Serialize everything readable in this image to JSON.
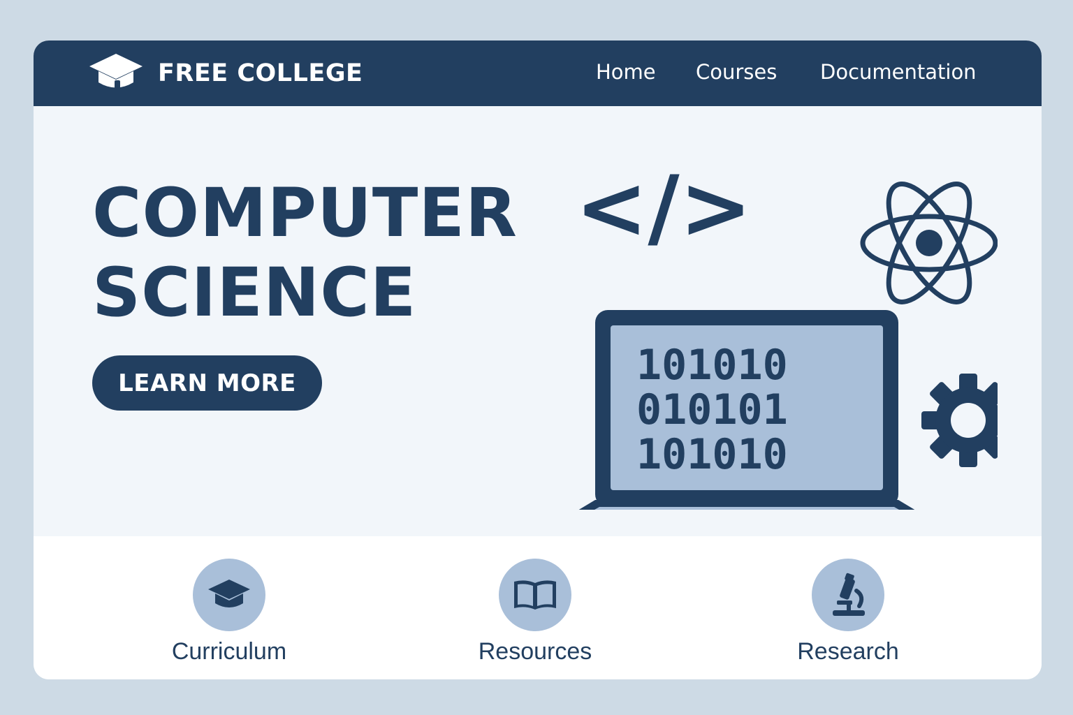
{
  "brand": {
    "name": "FREE COLLEGE",
    "icon": "graduation-cap-icon"
  },
  "nav": {
    "items": [
      {
        "label": "Home"
      },
      {
        "label": "Courses"
      },
      {
        "label": "Documentation"
      }
    ]
  },
  "hero": {
    "title_line1": "COMPUTER",
    "title_line2": "SCIENCE",
    "cta_label": "LEARN MORE",
    "code_symbol": "</>",
    "binary_lines": [
      "101010",
      "010101",
      "101010"
    ],
    "icons": [
      "code-icon",
      "atom-icon",
      "gear-icon",
      "laptop-icon"
    ]
  },
  "features": [
    {
      "label": "Curriculum",
      "icon": "graduation-cap-icon"
    },
    {
      "label": "Resources",
      "icon": "book-icon"
    },
    {
      "label": "Research",
      "icon": "microscope-icon"
    }
  ],
  "colors": {
    "primary": "#223f60",
    "page_background": "#cddae5",
    "hero_background": "#f2f6fa",
    "accent_light": "#a9bfd9"
  }
}
